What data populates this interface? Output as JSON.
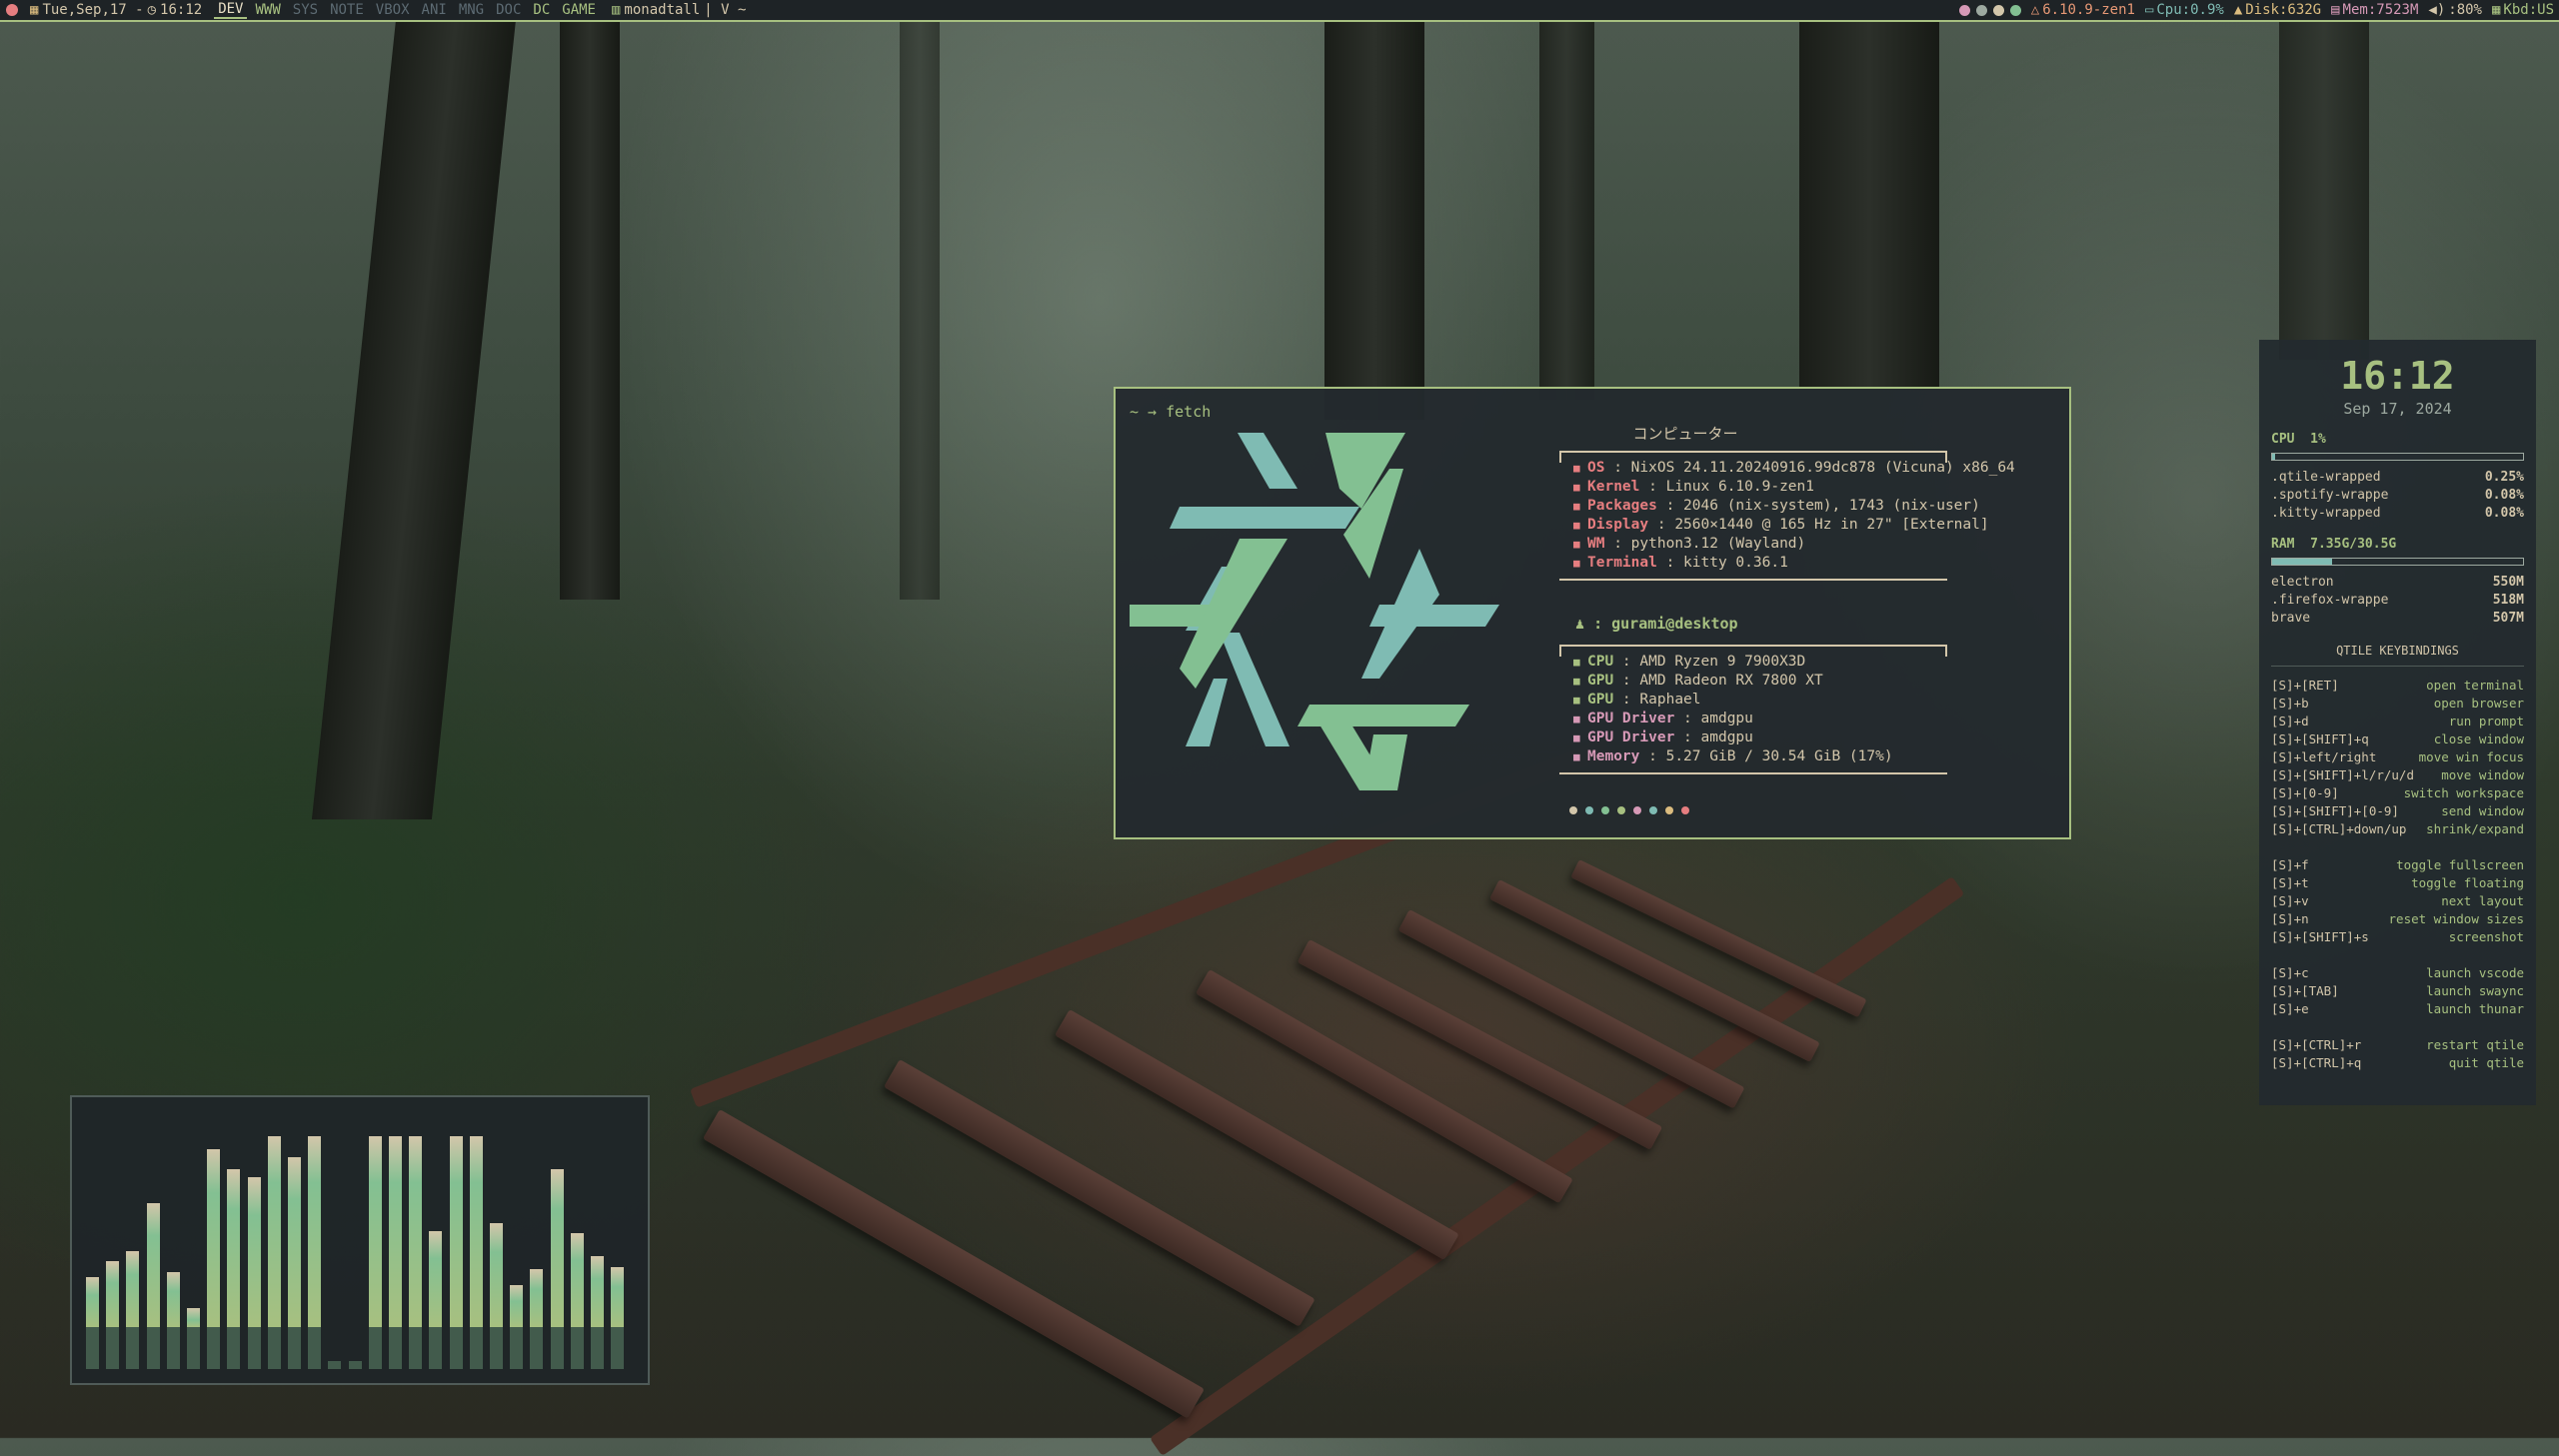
{
  "topbar": {
    "date": "Tue,Sep,17 -",
    "time": "16:12",
    "workspaces": [
      {
        "label": "DEV",
        "state": "active"
      },
      {
        "label": "WWW",
        "state": "occ"
      },
      {
        "label": "SYS",
        "state": "dim"
      },
      {
        "label": "NOTE",
        "state": "dim"
      },
      {
        "label": "VBOX",
        "state": "dim"
      },
      {
        "label": "ANI",
        "state": "dim"
      },
      {
        "label": "MNG",
        "state": "dim"
      },
      {
        "label": "DOC",
        "state": "dim"
      },
      {
        "label": "DC",
        "state": "occ"
      },
      {
        "label": "GAME",
        "state": "occ"
      }
    ],
    "layout": "monadtall",
    "window_title": "| V ~",
    "kernel": "6.10.9-zen1",
    "cpu": "Cpu:0.9%",
    "disk": "Disk:632G",
    "mem": "Mem:7523M",
    "vol": ":80%",
    "kbd": "Kbd:US"
  },
  "terminal": {
    "prompt": "~ → fetch",
    "hostname": "コンピューター",
    "sys": [
      {
        "key": "OS",
        "val": "NixOS 24.11.20240916.99dc878 (Vicuna) x86_64"
      },
      {
        "key": "Kernel",
        "val": "Linux 6.10.9-zen1"
      },
      {
        "key": "Packages",
        "val": "2046 (nix-system), 1743 (nix-user)"
      },
      {
        "key": "Display",
        "val": "2560×1440 @ 165 Hz in 27\" [External]"
      },
      {
        "key": "WM",
        "val": "python3.12 (Wayland)"
      },
      {
        "key": "Terminal",
        "val": "kitty 0.36.1"
      }
    ],
    "user": "gurami@desktop",
    "hw": [
      {
        "key": "CPU",
        "val": "AMD Ryzen 9 7900X3D",
        "c": "g"
      },
      {
        "key": "GPU",
        "val": "AMD Radeon RX 7800 XT",
        "c": "g"
      },
      {
        "key": "GPU",
        "val": "Raphael",
        "c": "g"
      },
      {
        "key": "GPU Driver",
        "val": "amdgpu",
        "c": "p"
      },
      {
        "key": "GPU Driver",
        "val": "amdgpu",
        "c": "p"
      },
      {
        "key": "Memory",
        "val": "5.27 GiB / 30.54 GiB (17%)",
        "c": "p"
      }
    ],
    "palette": [
      "#d3c6aa",
      "#7fbbb3",
      "#83c092",
      "#a7c080",
      "#d699b6",
      "#7fbbb3",
      "#dbbc7f",
      "#e67e80"
    ]
  },
  "panel": {
    "clock": "16:12",
    "date": "Sep 17, 2024",
    "cpu_label": "CPU",
    "cpu_value": "1%",
    "cpu_fill": 0.01,
    "cpu_procs": [
      {
        "name": ".qtile-wrapped",
        "val": "0.25%"
      },
      {
        "name": ".spotify-wrappe",
        "val": "0.08%"
      },
      {
        "name": ".kitty-wrapped",
        "val": "0.08%"
      }
    ],
    "ram_label": "RAM",
    "ram_value": "7.35G/30.5G",
    "ram_fill": 0.24,
    "ram_procs": [
      {
        "name": "electron",
        "val": "550M"
      },
      {
        "name": ".firefox-wrappe",
        "val": "518M"
      },
      {
        "name": "brave",
        "val": "507M"
      }
    ],
    "kb_title": "QTILE KEYBINDINGS",
    "kb_groups": [
      [
        {
          "k": "[S]+[RET]",
          "a": "open terminal"
        },
        {
          "k": "[S]+b",
          "a": "open browser"
        },
        {
          "k": "[S]+d",
          "a": "run prompt"
        },
        {
          "k": "[S]+[SHIFT]+q",
          "a": "close window"
        },
        {
          "k": "[S]+left/right",
          "a": "move win focus"
        },
        {
          "k": "[S]+[SHIFT]+l/r/u/d",
          "a": "move window"
        },
        {
          "k": "[S]+[0-9]",
          "a": "switch workspace"
        },
        {
          "k": "[S]+[SHIFT]+[0-9]",
          "a": "send window"
        },
        {
          "k": "[S]+[CTRL]+down/up",
          "a": "shrink/expand"
        }
      ],
      [
        {
          "k": "[S]+f",
          "a": "toggle fullscreen"
        },
        {
          "k": "[S]+t",
          "a": "toggle floating"
        },
        {
          "k": "[S]+v",
          "a": "next layout"
        },
        {
          "k": "[S]+n",
          "a": "reset window sizes"
        },
        {
          "k": "[S]+[SHIFT]+s",
          "a": "screenshot"
        }
      ],
      [
        {
          "k": "[S]+c",
          "a": "launch vscode"
        },
        {
          "k": "[S]+[TAB]",
          "a": "launch swaync"
        },
        {
          "k": "[S]+e",
          "a": "launch thunar"
        }
      ],
      [
        {
          "k": "[S]+[CTRL]+r",
          "a": "restart qtile"
        },
        {
          "k": "[S]+[CTRL]+q",
          "a": "quit qtile"
        }
      ]
    ]
  },
  "visualizer": {
    "levels": [
      0.36,
      0.42,
      0.46,
      0.65,
      0.38,
      0.24,
      0.86,
      0.78,
      0.75,
      0.91,
      0.83,
      0.91,
      0.03,
      0.03,
      0.91,
      0.91,
      0.91,
      0.54,
      0.91,
      0.91,
      0.57,
      0.33,
      0.39,
      0.78,
      0.53,
      0.44,
      0.4
    ],
    "colors": {
      "low": "#a7c080",
      "mid": "#83c092",
      "high": "#d3c6aa"
    }
  }
}
